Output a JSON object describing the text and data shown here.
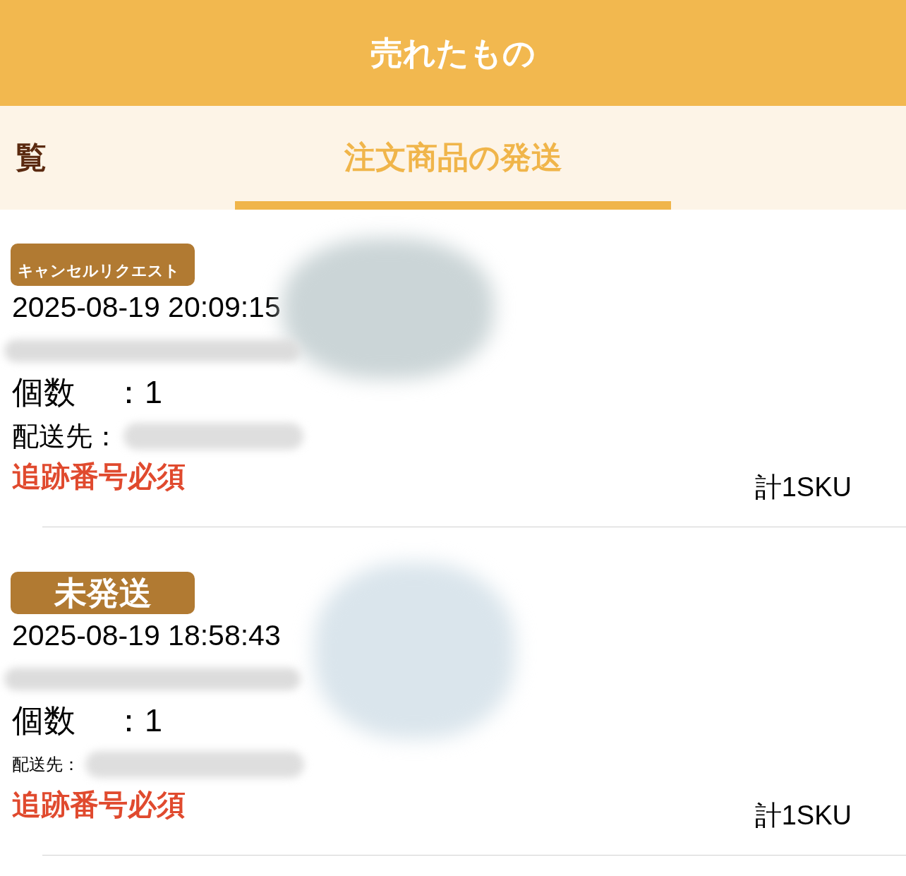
{
  "header": {
    "title": "売れたもの"
  },
  "tabs": [
    {
      "label": "覧",
      "selected": false
    },
    {
      "label": "注文商品の発送",
      "selected": true
    }
  ],
  "orders": [
    {
      "status": {
        "label": "キャンセルリクエスト",
        "kind": "cancel_request"
      },
      "date": "2025-08-19 20:09:15",
      "quantity": {
        "label": "個数",
        "value": "：1"
      },
      "destination": {
        "label": "配送先：",
        "kind": "large"
      },
      "tracking_notice": "追跡番号必須",
      "sku_total": "計1SKU"
    },
    {
      "status": {
        "label": "未発送",
        "kind": "unshipped"
      },
      "date": "2025-08-19 18:58:43",
      "quantity": {
        "label": "個数",
        "value": "：1"
      },
      "destination": {
        "label": "配送先：",
        "kind": "small"
      },
      "tracking_notice": "追跡番号必須",
      "sku_total": "計1SKU"
    }
  ]
}
